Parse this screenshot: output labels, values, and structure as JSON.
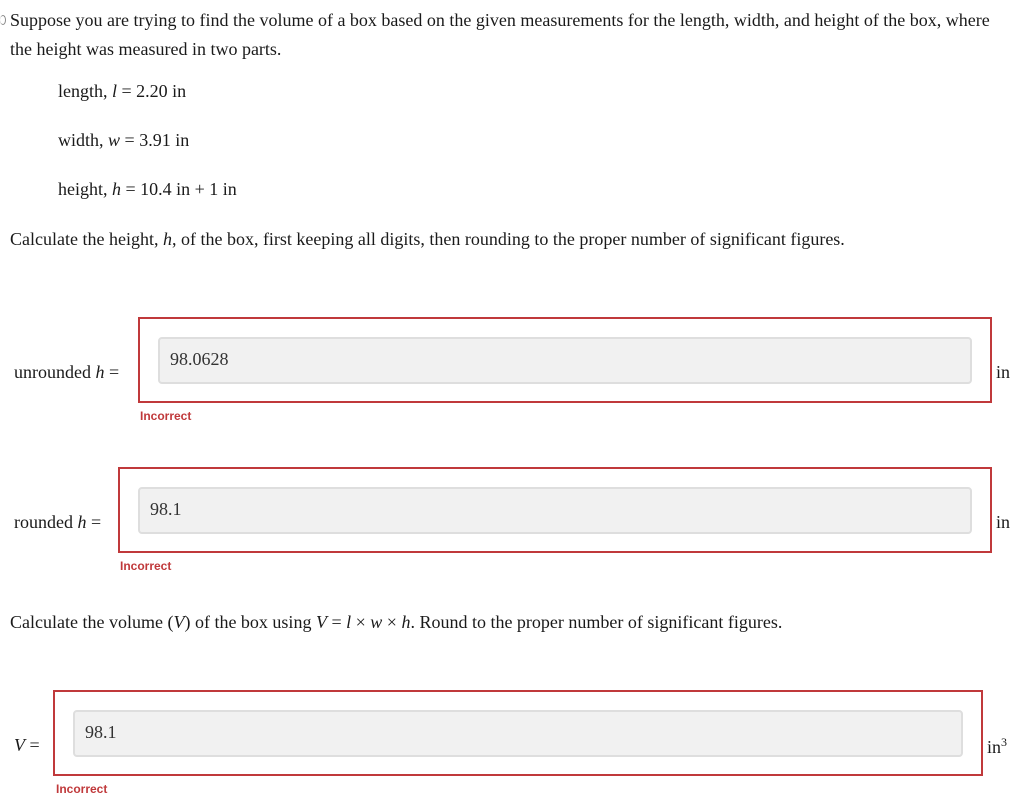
{
  "intro": {
    "text": "Suppose you are trying to find the volume of a box based on the given measurements for the length, width, and height of the box, where the height was measured in two parts."
  },
  "given": [
    {
      "label": "length, ",
      "var": "l",
      "value": "2.20 in"
    },
    {
      "label": "width, ",
      "var": "w",
      "value": "3.91 in"
    },
    {
      "label": "height, ",
      "var": "h",
      "value": "10.4 in + 1 in"
    }
  ],
  "question1": {
    "text_a": "Calculate the height, ",
    "var": "h",
    "text_b": ", of the box, first keeping all digits, then rounding to the proper number of significant figures."
  },
  "answers": [
    {
      "label_pre": "unrounded ",
      "var": "h",
      "value": "98.0628",
      "status": "Incorrect",
      "unit": "in",
      "unit_sup": ""
    },
    {
      "label_pre": "rounded ",
      "var": "h",
      "value": "98.1",
      "status": "Incorrect",
      "unit": "in",
      "unit_sup": ""
    },
    {
      "label_pre": "",
      "var": "V",
      "value": "98.1",
      "status": "Incorrect",
      "unit": "in",
      "unit_sup": "3"
    }
  ],
  "question2": {
    "text_a": "Calculate the volume (",
    "var_v": "V",
    "text_b": ") of the box using ",
    "formula_v": "V",
    "eq": " = ",
    "f_l": "l",
    "times1": " × ",
    "f_w": "w",
    "times2": " × ",
    "f_h": "h",
    "text_c": ". Round to the proper number of significant figures."
  },
  "equals": " ="
}
